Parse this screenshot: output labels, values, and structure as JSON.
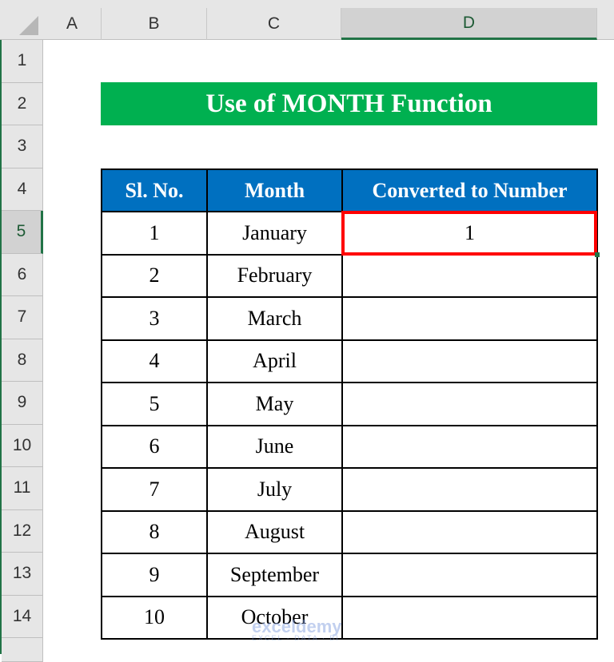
{
  "columns": [
    "A",
    "B",
    "C",
    "D"
  ],
  "selected_column": "D",
  "rows": [
    "1",
    "2",
    "3",
    "4",
    "5",
    "6",
    "7",
    "8",
    "9",
    "10",
    "11",
    "12",
    "13",
    "14"
  ],
  "selected_row": "5",
  "title": "Use of MONTH Function",
  "table": {
    "headers": [
      "Sl. No.",
      "Month",
      "Converted to Number"
    ],
    "rows": [
      {
        "sl": "1",
        "month": "January",
        "number": "1"
      },
      {
        "sl": "2",
        "month": "February",
        "number": ""
      },
      {
        "sl": "3",
        "month": "March",
        "number": ""
      },
      {
        "sl": "4",
        "month": "April",
        "number": ""
      },
      {
        "sl": "5",
        "month": "May",
        "number": ""
      },
      {
        "sl": "6",
        "month": "June",
        "number": ""
      },
      {
        "sl": "7",
        "month": "July",
        "number": ""
      },
      {
        "sl": "8",
        "month": "August",
        "number": ""
      },
      {
        "sl": "9",
        "month": "September",
        "number": ""
      },
      {
        "sl": "10",
        "month": "October",
        "number": ""
      }
    ]
  },
  "colors": {
    "title_bg": "#00b050",
    "header_bg": "#0070c0",
    "highlight": "#ff0000",
    "excel_green": "#217346"
  },
  "watermark": {
    "brand": "exceldemy",
    "tagline": "EXCEL · DATA · BI"
  }
}
